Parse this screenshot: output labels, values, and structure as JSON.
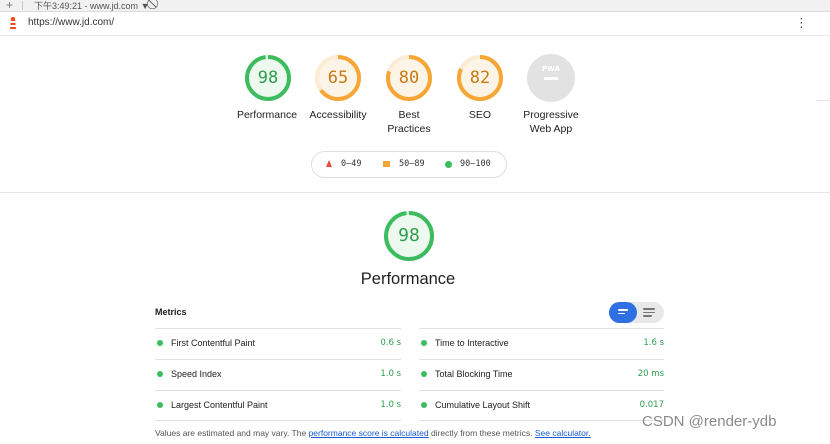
{
  "top_strip": {
    "selection_text": "下午3:49:21 - www.jd.com",
    "dropdown_glyph": "▼",
    "plus_glyph": "+",
    "block_glyph": "⃠"
  },
  "url_bar": {
    "url": "https://www.jd.com/",
    "menu_glyph": "⋮"
  },
  "categories": [
    {
      "label": "Performance",
      "score": "98",
      "fraction": 0.98,
      "color": "#3cbc5e",
      "track": "#e5f5e9",
      "fill": "#edf8ef"
    },
    {
      "label": "Accessibility",
      "score": "65",
      "fraction": 0.65,
      "color": "#f5a637",
      "track": "#fcecd5",
      "fill": "#fdf4e8"
    },
    {
      "label_line1": "Best",
      "label_line2": "Practices",
      "score": "80",
      "fraction": 0.8,
      "color": "#f5a637",
      "track": "#fcecd5",
      "fill": "#fdf4e8"
    },
    {
      "label": "SEO",
      "score": "82",
      "fraction": 0.82,
      "color": "#f5a637",
      "track": "#fcecd5",
      "fill": "#fdf4e8"
    },
    {
      "label_line1": "Progressive",
      "label_line2": "Web App",
      "badge": "PWA",
      "color": "#cfcfcf"
    }
  ],
  "legend": {
    "fail": "0–49",
    "average": "50–89",
    "pass": "90–100"
  },
  "performance": {
    "title": "Performance",
    "score": "98",
    "fraction": 0.98,
    "color": "#3cbc5e"
  },
  "metrics": {
    "heading": "Metrics",
    "left": [
      {
        "name": "First Contentful Paint",
        "value": "0.6 s"
      },
      {
        "name": "Speed Index",
        "value": "1.0 s"
      },
      {
        "name": "Largest Contentful Paint",
        "value": "1.0 s"
      }
    ],
    "right": [
      {
        "name": "Time to Interactive",
        "value": "1.6 s"
      },
      {
        "name": "Total Blocking Time",
        "value": "20 ms"
      },
      {
        "name": "Cumulative Layout Shift",
        "value": "0.017"
      }
    ]
  },
  "footer": {
    "text1": "Values are estimated and may vary. The ",
    "link1": "performance score is calculated",
    "text2": " directly from these metrics. ",
    "link2": "See calculator."
  },
  "watermark": "CSDN @render-ydb",
  "colors": {
    "pass": "#3cbc5e",
    "average": "#f5a637",
    "fail": "#ec4b40",
    "toggle_active": "#2f6fe4"
  }
}
